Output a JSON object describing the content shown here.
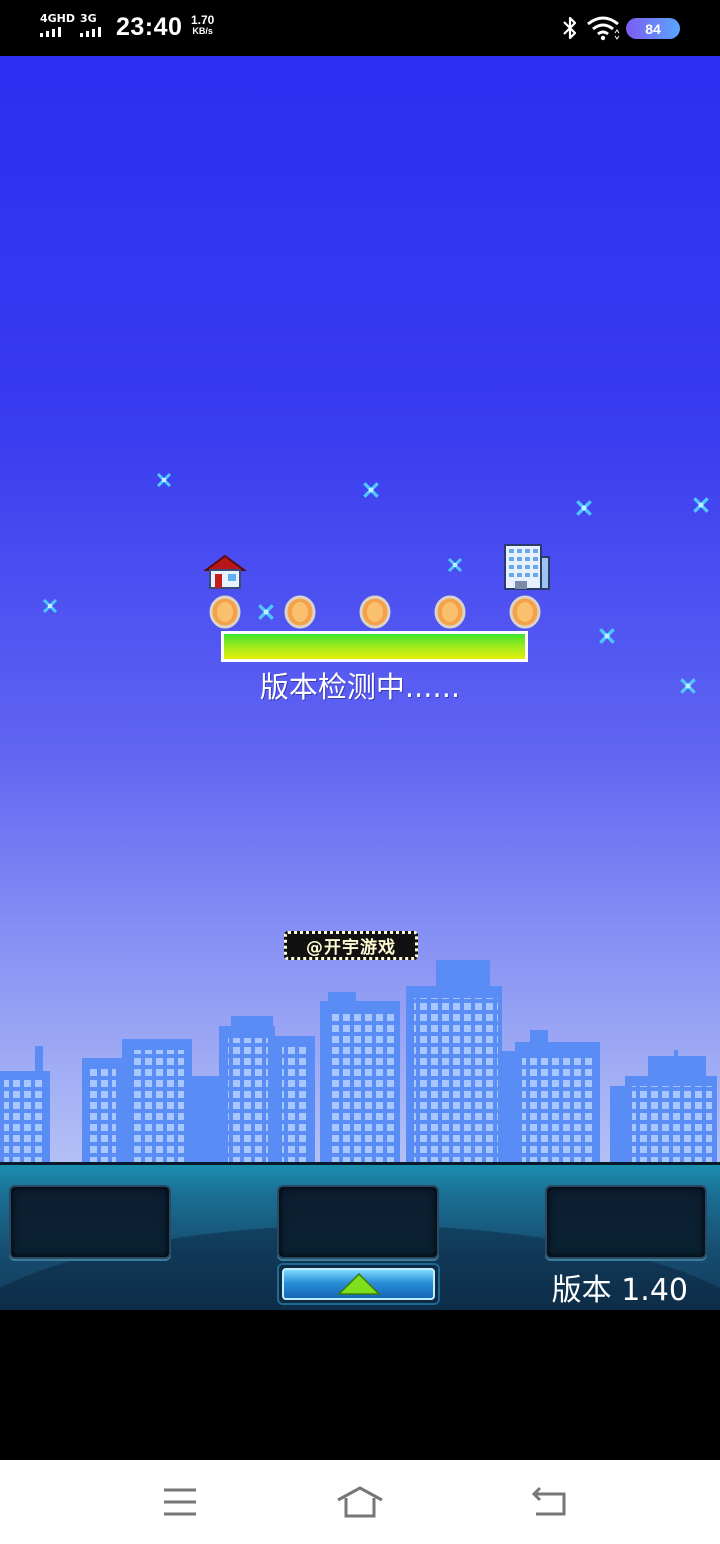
{
  "status_bar": {
    "network1": "4GHD",
    "network2": "3G",
    "time": "23:40",
    "speed_value": "1.70",
    "speed_unit": "KB/s",
    "battery": "84",
    "icons": [
      "bluetooth-icon",
      "wifi-icon",
      "battery-icon"
    ]
  },
  "game": {
    "loading_text": "版本检测中......",
    "loading_progress": 1.0,
    "logo_text": "@开宇游戏",
    "version_label": "版本 1.40",
    "icons": [
      "house-icon",
      "coin-icon",
      "building-icon",
      "sparkle-icon",
      "skyline-image",
      "up-arrow-icon"
    ],
    "colors": {
      "sky_top": "#2d2ef0",
      "sky_bottom": "#c8d3f4",
      "progress_fill": "#8fe820",
      "panel": "#1a6d92"
    }
  },
  "nav_bar": {
    "icons": [
      "menu-icon",
      "home-icon",
      "back-icon"
    ]
  }
}
